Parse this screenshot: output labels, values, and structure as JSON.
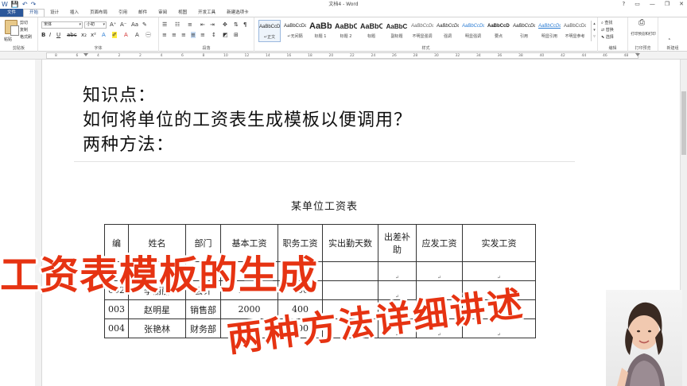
{
  "window": {
    "title": "文档4 - Word",
    "qat": [
      "W",
      "💾",
      "↶",
      "↷"
    ],
    "controls": [
      "?",
      "▭",
      "—",
      "❐",
      "✕"
    ]
  },
  "tabs": [
    "文件",
    "开始",
    "设计",
    "插入",
    "页面布局",
    "引用",
    "邮件",
    "审阅",
    "视图",
    "开发工具",
    "新建选项卡"
  ],
  "ribbon": {
    "clipboard": {
      "paste": "粘贴",
      "cut": "剪切",
      "copy": "复制",
      "format_painter": "格式刷",
      "label": "剪贴板"
    },
    "font": {
      "name": "宋体",
      "size": "小初",
      "label": "字体"
    },
    "paragraph": {
      "label": "段落"
    },
    "styles": {
      "label": "样式",
      "items": [
        {
          "sample": "AaBbCcDd",
          "name": "↵正文"
        },
        {
          "sample": "AaBbCcDd",
          "name": "↵无间隔"
        },
        {
          "sample": "AaBb",
          "name": "标题 1"
        },
        {
          "sample": "AaBbC",
          "name": "标题 2"
        },
        {
          "sample": "AaBbC",
          "name": "标题"
        },
        {
          "sample": "AaBbC",
          "name": "副标题"
        },
        {
          "sample": "AaBbCcDd",
          "name": "不明显强调"
        },
        {
          "sample": "AaBbCcDd",
          "name": "强调"
        },
        {
          "sample": "AaBbCcDd",
          "name": "明显强调"
        },
        {
          "sample": "AaBbCcDd",
          "name": "要点"
        },
        {
          "sample": "AaBbCcDd",
          "name": "引用"
        },
        {
          "sample": "AaBbCcDd",
          "name": "明显引用"
        },
        {
          "sample": "AaBbCcDd",
          "name": "不明显参考"
        }
      ]
    },
    "editing": {
      "find": "查找",
      "replace": "替换",
      "select": "选择",
      "label": "编辑"
    },
    "print": {
      "preview": "打印预览和打印",
      "label": "打印预览"
    },
    "new_group": {
      "label": "新建组"
    }
  },
  "ruler_numbers": [
    "8",
    "6",
    "4",
    "2",
    "2",
    "4",
    "6",
    "8",
    "10",
    "12",
    "14",
    "16",
    "18",
    "20",
    "22",
    "24",
    "26",
    "28",
    "30",
    "32",
    "34",
    "36",
    "38",
    "40",
    "42",
    "44",
    "46",
    "48"
  ],
  "document": {
    "lines": [
      "知识点：",
      "如何将单位的工资表生成模板以便调用？",
      "两种方法："
    ],
    "table_title": "某单位工资表",
    "headers": [
      "编",
      "姓名",
      "部门",
      "基本工资",
      "职务工资",
      "实出勤天数",
      "出差补助",
      "应发工资",
      "实发工资"
    ],
    "rows": [
      [
        "",
        "",
        "",
        "",
        "",
        "",
        "↵",
        "↵",
        "↵"
      ],
      [
        "002",
        "李丽丽",
        "会计",
        "3000",
        "600",
        "",
        "↵",
        "↵",
        "↵"
      ],
      [
        "003",
        "赵明星",
        "销售部",
        "2000",
        "400",
        "",
        "↵",
        "↵",
        "↵"
      ],
      [
        "004",
        "张艳林",
        "财务部",
        "3000",
        "500",
        "",
        "↵",
        "↵",
        "↵"
      ]
    ]
  },
  "overlay": {
    "title": "工资表模板的生成",
    "subtitle": "两种方法详细讲述",
    "color": "#e63312"
  }
}
